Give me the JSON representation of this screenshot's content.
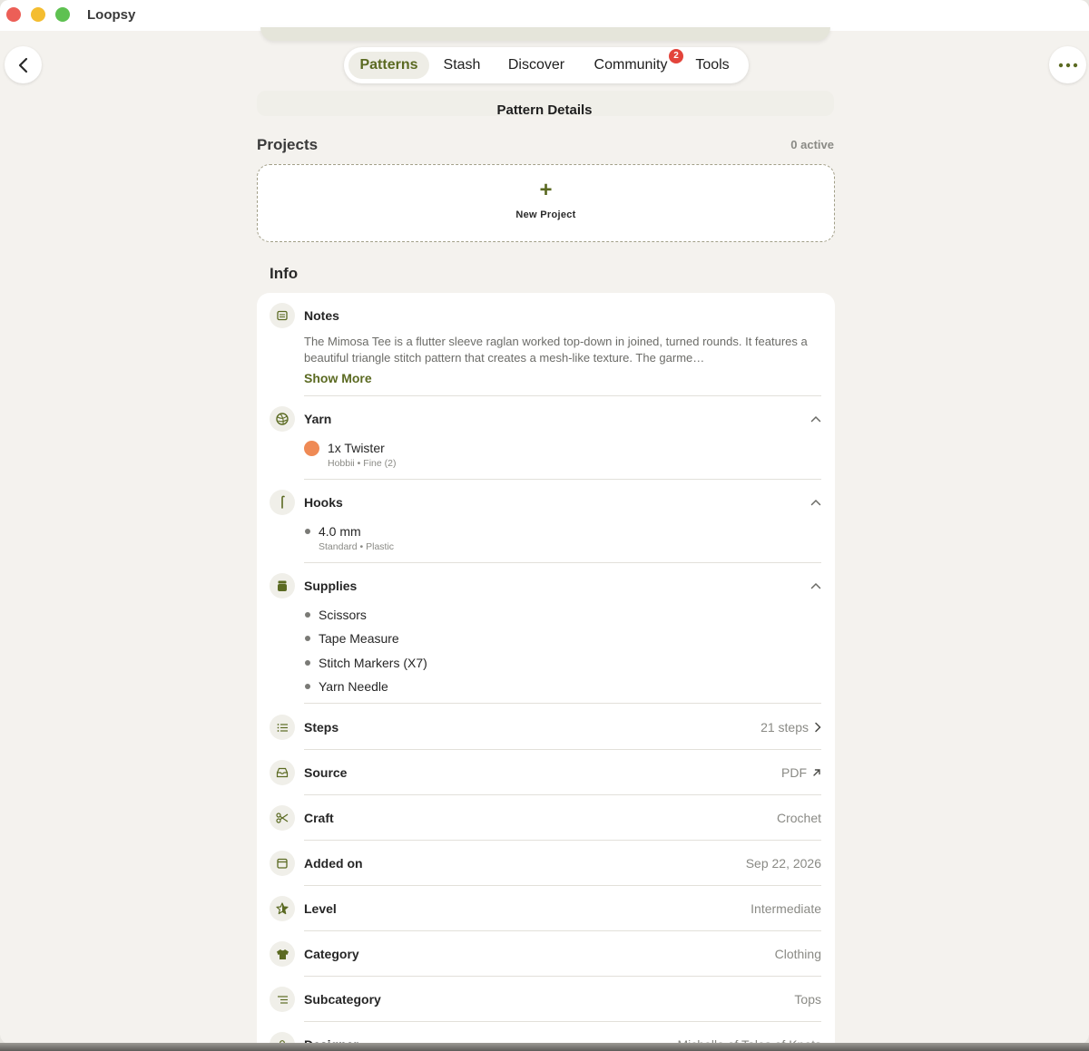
{
  "app": {
    "title": "Loopsy"
  },
  "nav": {
    "tabs": [
      {
        "label": "Patterns",
        "active": true
      },
      {
        "label": "Stash"
      },
      {
        "label": "Discover"
      },
      {
        "label": "Community",
        "badge": "2"
      },
      {
        "label": "Tools"
      }
    ],
    "back_icon": "chevron-left-icon",
    "more_icon": "ellipsis-icon"
  },
  "page": {
    "title": "Pattern Details"
  },
  "projects": {
    "heading": "Projects",
    "count": "0 active",
    "new_project_label": "New Project",
    "new_project_icon": "+"
  },
  "info": {
    "heading": "Info",
    "notes": {
      "label": "Notes",
      "text": "The Mimosa Tee is a flutter sleeve raglan worked top-down in joined, turned rounds. It features a beautiful triangle stitch pattern that creates a mesh-like texture. The garme…",
      "show_more": "Show More"
    },
    "yarn": {
      "label": "Yarn",
      "items": [
        {
          "name": "1x Twister",
          "detail": "Hobbii • Fine (2)",
          "color": "#ef8a55"
        }
      ]
    },
    "hooks": {
      "label": "Hooks",
      "items": [
        {
          "name": "4.0 mm",
          "detail": "Standard • Plastic"
        }
      ]
    },
    "supplies": {
      "label": "Supplies",
      "items": [
        "Scissors",
        "Tape Measure",
        "Stitch Markers (X7)",
        "Yarn Needle"
      ]
    },
    "rows": [
      {
        "label": "Steps",
        "value": "21 steps",
        "icon": "list-icon",
        "trailing": "chevron-right-icon"
      },
      {
        "label": "Source",
        "value": "PDF",
        "icon": "inbox-icon",
        "trailing": "external-link-icon"
      },
      {
        "label": "Craft",
        "value": "Crochet",
        "icon": "scissors-icon"
      },
      {
        "label": "Added on",
        "value": "Sep 22, 2026",
        "icon": "calendar-icon"
      },
      {
        "label": "Level",
        "value": "Intermediate",
        "icon": "star-icon"
      },
      {
        "label": "Category",
        "value": "Clothing",
        "icon": "shirt-icon"
      },
      {
        "label": "Subcategory",
        "value": "Tops",
        "icon": "list-icon"
      },
      {
        "label": "Designer",
        "value": "Michelle of Tales of Knots",
        "icon": "person-icon"
      }
    ]
  },
  "colors": {
    "accent": "#5b6a22",
    "background": "#f4f2ee",
    "card": "#ffffff",
    "badge": "#e3443b"
  }
}
